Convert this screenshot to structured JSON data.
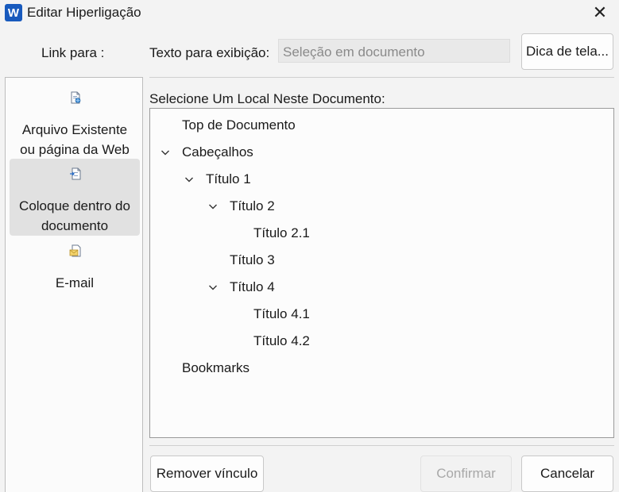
{
  "window": {
    "app_icon": "W",
    "title": "Editar Hiperligação",
    "close_glyph": "✕"
  },
  "header": {
    "link_para_label": "Link para :",
    "texto_label": "Texto para exibição:",
    "texto_placeholder": "Seleção em documento",
    "dica_button": "Dica de tela..."
  },
  "link_to": {
    "items": [
      {
        "icon": "document-web-icon",
        "line1": "Arquivo Existente",
        "line2": "ou página da Web",
        "selected": false
      },
      {
        "icon": "document-place-icon",
        "line1": "Coloque dentro do",
        "line2": "documento",
        "selected": true
      },
      {
        "icon": "email-icon",
        "line1": "E-mail",
        "line2": "",
        "selected": false
      }
    ]
  },
  "location": {
    "label": "Selecione Um Local Neste Documento:",
    "tree": [
      {
        "label": "Top de Documento",
        "level": 0,
        "expander": "none"
      },
      {
        "label": "Cabeçalhos",
        "level": 0,
        "expander": "expanded"
      },
      {
        "label": "Título 1",
        "level": 1,
        "expander": "expanded"
      },
      {
        "label": "Título 2",
        "level": 2,
        "expander": "expanded"
      },
      {
        "label": "Título 2.1",
        "level": 3,
        "expander": "none"
      },
      {
        "label": "Título 3",
        "level": 2,
        "expander": "none"
      },
      {
        "label": "Título 4",
        "level": 2,
        "expander": "expanded"
      },
      {
        "label": "Título 4.1",
        "level": 3,
        "expander": "none"
      },
      {
        "label": "Título 4.2",
        "level": 3,
        "expander": "none"
      },
      {
        "label": "Bookmarks",
        "level": 0,
        "expander": "none"
      }
    ]
  },
  "footer": {
    "remover_button": "Remover vínculo",
    "confirmar_button": "Confirmar",
    "cancelar_button": "Cancelar"
  },
  "colors": {
    "app_icon_bg": "#185abd",
    "selected_item_bg": "#e1e1e1",
    "disabled_text": "#a8a8a8"
  }
}
